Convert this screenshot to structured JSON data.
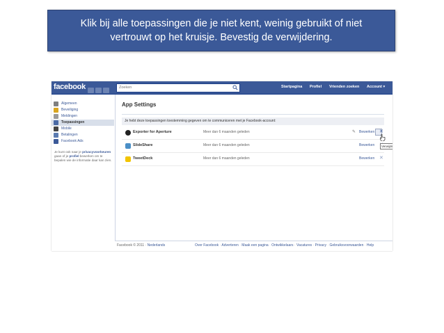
{
  "banner": {
    "line1": "Klik bij alle toepassingen die je niet kent, weinig gebruikt of niet",
    "line2": "vertrouwt op het kruisje. Bevestig de verwijdering."
  },
  "facebook": {
    "logo": "facebook",
    "search_placeholder": "Zoeken",
    "nav": [
      "Startpagina",
      "Profiel",
      "Vrienden zoeken",
      "Account ▾"
    ],
    "sidebar": [
      {
        "label": "Algemeen",
        "color": "#7f7f7f"
      },
      {
        "label": "Beveiliging",
        "color": "#d9a520"
      },
      {
        "label": "Meldingen",
        "color": "#9a9a9a"
      },
      {
        "label": "Toepassingen",
        "color": "#4a6aa5"
      },
      {
        "label": "Mobile",
        "color": "#444444"
      },
      {
        "label": "Betalingen",
        "color": "#5b7bb0"
      },
      {
        "label": "Facebook Ads",
        "color": "#3b5998"
      }
    ],
    "sidebar_note": {
      "t1": "Je kunt ook naar je",
      "link1": "privacyvoorkeuren",
      "t2": "gaan of je",
      "link2": "profiel",
      "t3": "bewerken om te bepalen wie de informatie daar kan zien."
    },
    "page_title": "App Settings",
    "intro": "Je hebt deze toepassingen toestemming gegeven om te communiceren met je Facebook-account:",
    "apps": [
      {
        "name": "Exporter for Aperture",
        "when": "Meer dan 6 maanden geleden",
        "edit": "Bewerken",
        "remove": "✕",
        "icon_color": "#222222"
      },
      {
        "name": "SlideShare",
        "when": "Meer dan 6 maanden geleden",
        "edit": "Bewerken",
        "remove": "✕",
        "icon_color": "#4a8fc7"
      },
      {
        "name": "TweetDeck",
        "when": "Meer dan 6 maanden geleden",
        "edit": "Bewerken",
        "remove": "✕",
        "icon_color": "#f2c400"
      }
    ],
    "tooltip": "Verwijderen",
    "footer": {
      "copyright": "Facebook © 2011 ·",
      "language": "Nederlands",
      "links": [
        "Over Facebook",
        "Adverteren",
        "Maak een pagina",
        "Ontwikkelaars",
        "Vacatures",
        "Privacy",
        "Gebruiksvoorwaarden",
        "Help"
      ]
    }
  }
}
